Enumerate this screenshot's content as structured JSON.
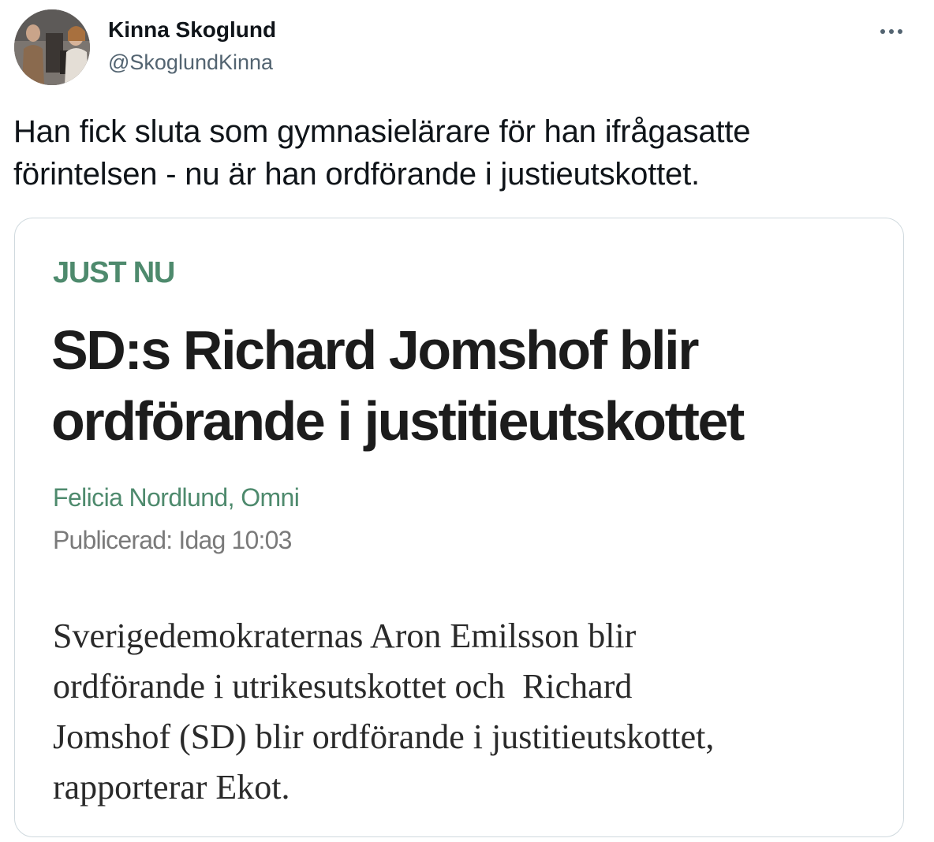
{
  "user": {
    "display_name": "Kinna Skoglund",
    "handle": "@SkoglundKinna"
  },
  "header": {
    "more_icon": "more-horizontal-icon"
  },
  "tweet": {
    "text": "Han fick sluta som gymnasielärare för han ifrågasatte\nförintelsen - nu är han ordförande i justieutskottet."
  },
  "article": {
    "kicker": "JUST NU",
    "headline": "SD:s Richard Jomshof blir ordförande i justitieutskottet",
    "byline": "Felicia Nordlund, Omni",
    "published": "Publicerad: Idag 10:03",
    "body": "Sverigedemokraternas Aron Emilsson blir\nordförande i utrikesutskottet och  Richard\nJomshof (SD) blir ordförande i justitieutskottet,\nrapporterar Ekot."
  },
  "colors": {
    "accent_green": "#4e8a6d",
    "text_primary": "#0f1419",
    "text_secondary": "#536471",
    "card_border": "#cfd9de"
  }
}
